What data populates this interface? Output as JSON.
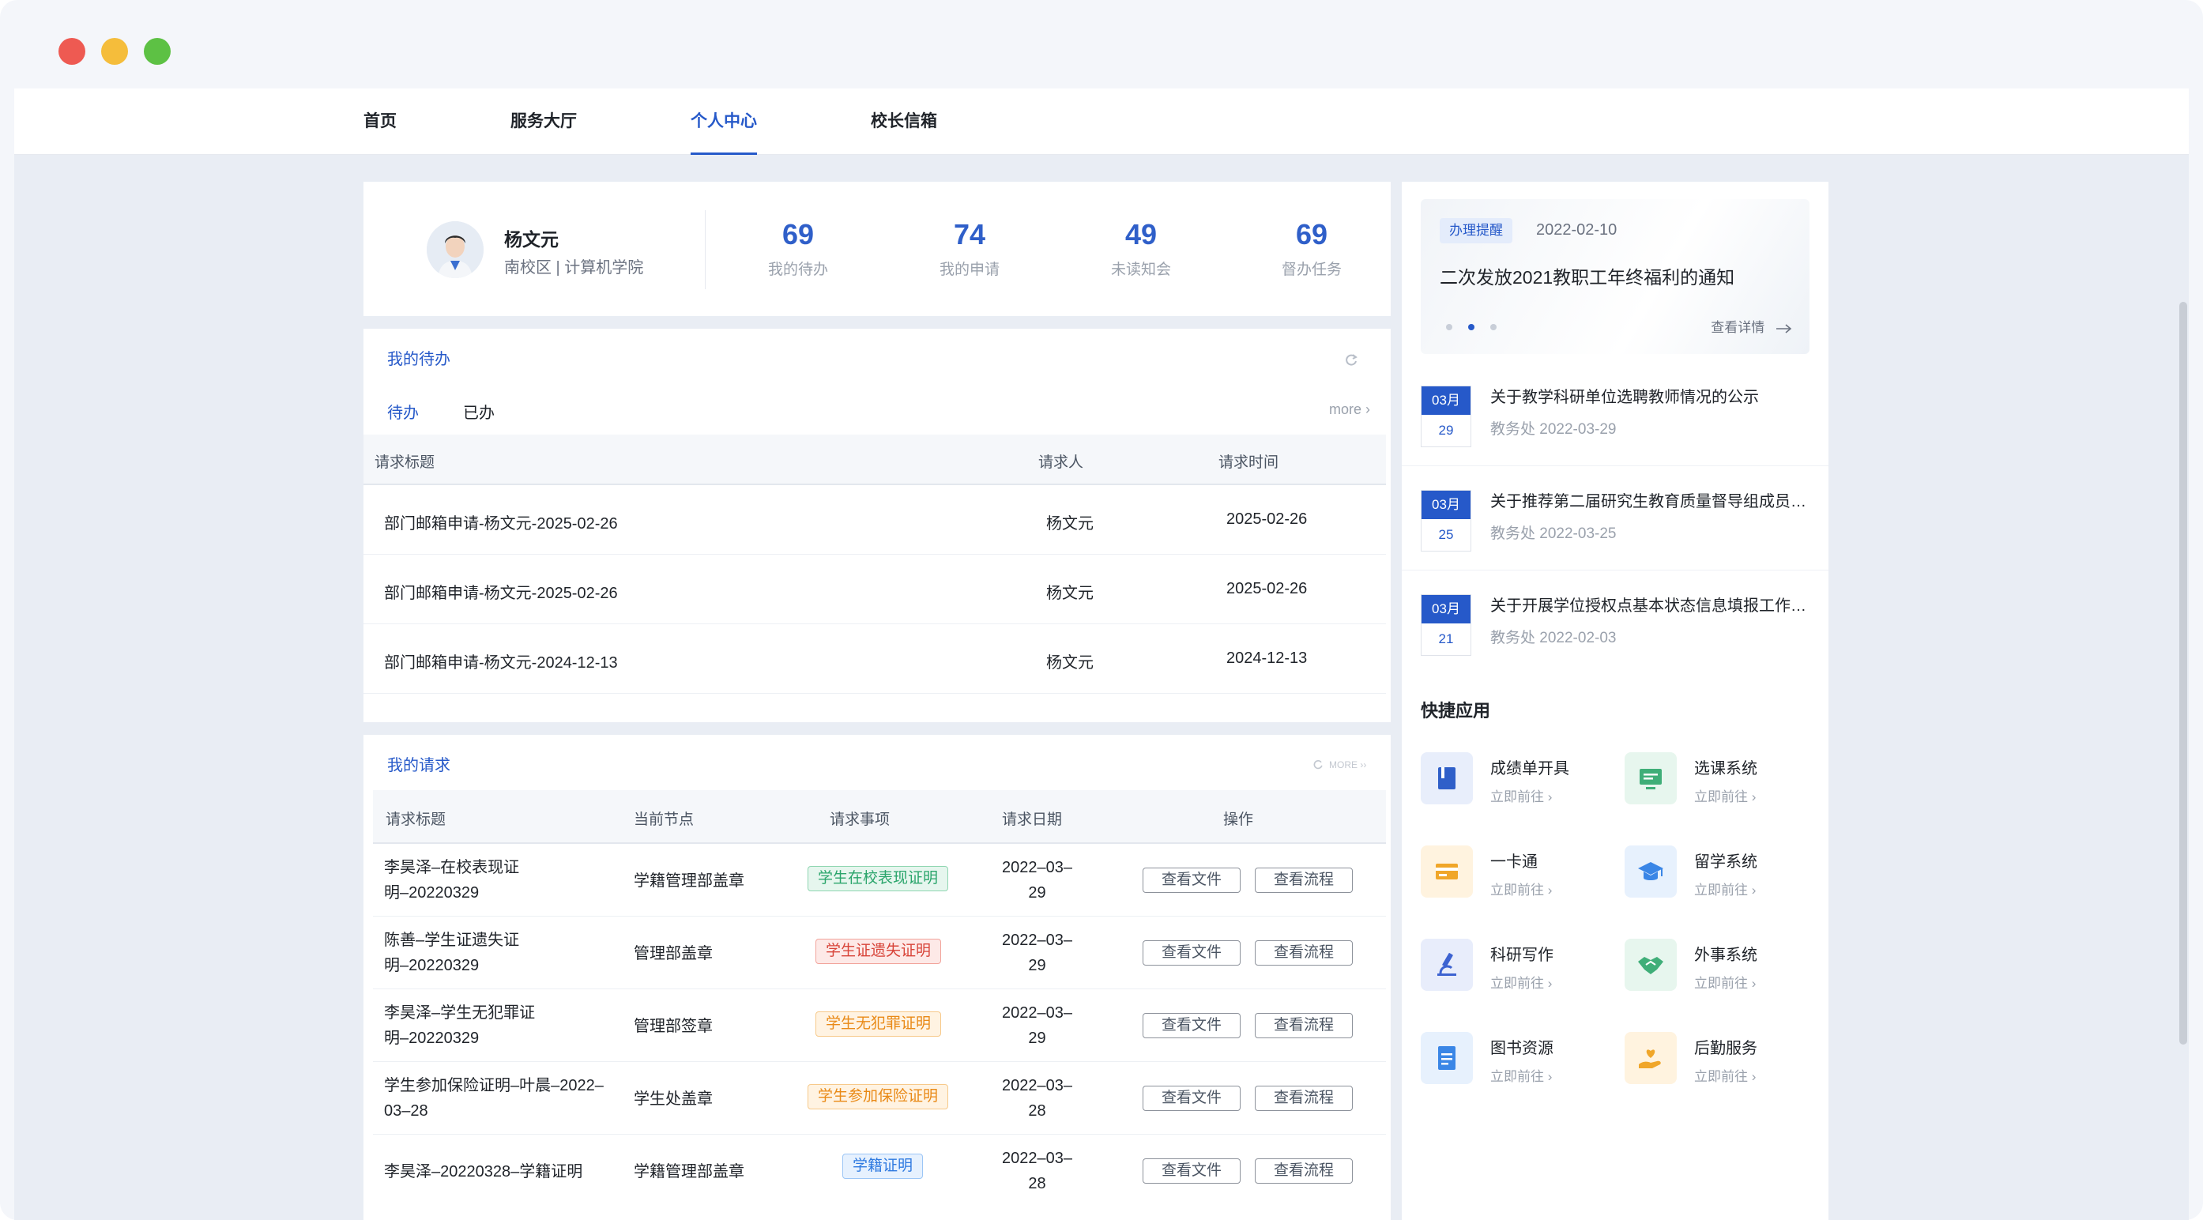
{
  "nav": {
    "items": [
      {
        "label": "首页"
      },
      {
        "label": "服务大厅"
      },
      {
        "label": "个人中心"
      },
      {
        "label": "校长信箱"
      }
    ],
    "active_index": 2
  },
  "profile": {
    "name": "杨文元",
    "meta": "南校区 | 计算机学院",
    "stats": [
      {
        "value": "69",
        "label": "我的待办"
      },
      {
        "value": "74",
        "label": "我的申请"
      },
      {
        "value": "49",
        "label": "未读知会"
      },
      {
        "value": "69",
        "label": "督办任务"
      }
    ]
  },
  "todo": {
    "title": "我的待办",
    "tabs": [
      "待办",
      "已办"
    ],
    "more": "more ›",
    "columns": [
      "请求标题",
      "请求人",
      "请求时间"
    ],
    "rows": [
      {
        "title": "部门邮箱申请-杨文元-2025-02-26",
        "requester": "杨文元",
        "time": "2025-02-26"
      },
      {
        "title": "部门邮箱申请-杨文元-2025-02-26",
        "requester": "杨文元",
        "time": "2025-02-26"
      },
      {
        "title": "部门邮箱申请-杨文元-2024-12-13",
        "requester": "杨文元",
        "time": "2024-12-13"
      }
    ]
  },
  "requests": {
    "title": "我的请求",
    "more": "MORE ››",
    "columns": [
      "请求标题",
      "当前节点",
      "请求事项",
      "请求日期",
      "操作"
    ],
    "btn_file": "查看文件",
    "btn_flow": "查看流程",
    "rows": [
      {
        "title1": "李昊泽–在校表现证",
        "title2": "明–20220329",
        "node": "学籍管理部盖章",
        "tag": "学生在校表现证明",
        "tag_color": "green",
        "date1": "2022–03–",
        "date2": "29"
      },
      {
        "title1": "陈善–学生证遗失证",
        "title2": "明–20220329",
        "node": "管理部盖章",
        "tag": "学生证遗失证明",
        "tag_color": "red",
        "date1": "2022–03–",
        "date2": "29"
      },
      {
        "title1": "李昊泽–学生无犯罪证",
        "title2": "明–20220329",
        "node": "管理部签章",
        "tag": "学生无犯罪证明",
        "tag_color": "orange",
        "date1": "2022–03–",
        "date2": "29"
      },
      {
        "title1": "学生参加保险证明–叶晨–2022–",
        "title2": "03–28",
        "node": "学生处盖章",
        "tag": "学生参加保险证明",
        "tag_color": "orange",
        "date1": "2022–03–",
        "date2": "28"
      },
      {
        "title1": "李昊泽–20220328–学籍证明",
        "title2": "",
        "node": "学籍管理部盖章",
        "tag": "学籍证明",
        "tag_color": "blue",
        "date1": "2022–03–",
        "date2": "28"
      }
    ]
  },
  "banner": {
    "tag": "办理提醒",
    "date": "2022-02-10",
    "title": "二次发放2021教职工年终福利的通知",
    "link": "查看详情",
    "active_dot": 1
  },
  "notices": [
    {
      "month": "03月",
      "day": "29",
      "title": "关于教学科研单位选聘教师情况的公示",
      "meta": "教务处 2022-03-29"
    },
    {
      "month": "03月",
      "day": "25",
      "title": "关于推荐第二届研究生教育质量督导组成员的通知",
      "meta": "教务处 2022-03-25"
    },
    {
      "month": "03月",
      "day": "21",
      "title": "关于开展学位授权点基本状态信息填报工作的通知",
      "meta": "教务处 2022-02-03"
    }
  ],
  "quick": {
    "title": "快捷应用",
    "go_label": "立即前往 ›",
    "apps": [
      {
        "name": "成绩单开具",
        "icon": "book-icon",
        "color": "#2f5fc9",
        "bg": "#e8eefb"
      },
      {
        "name": "选课系统",
        "icon": "screen-icon",
        "color": "#3fae78",
        "bg": "#e7f6ee"
      },
      {
        "name": "一卡通",
        "icon": "card-icon",
        "color": "#f0a629",
        "bg": "#fff3df"
      },
      {
        "name": "留学系统",
        "icon": "graduation-cap-icon",
        "color": "#3a86e6",
        "bg": "#e7f1fd"
      },
      {
        "name": "科研写作",
        "icon": "microscope-icon",
        "color": "#3d63d1",
        "bg": "#e8edfb"
      },
      {
        "name": "外事系统",
        "icon": "handshake-icon",
        "color": "#3fae78",
        "bg": "#e7f6ee"
      },
      {
        "name": "图书资源",
        "icon": "document-icon",
        "color": "#3a86e6",
        "bg": "#e7f1fd"
      },
      {
        "name": "后勤服务",
        "icon": "hand-heart-icon",
        "color": "#f0a629",
        "bg": "#fff3df"
      }
    ]
  }
}
